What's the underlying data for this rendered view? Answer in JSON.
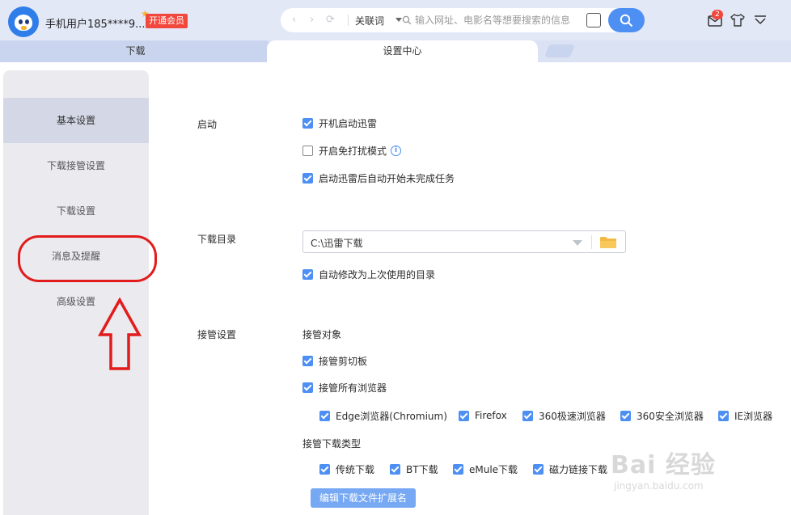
{
  "header": {
    "username": "手机用户185****9...",
    "vip_label": "开通会员",
    "message_count": "2"
  },
  "addressbar": {
    "search_mode": "关联词",
    "placeholder": "输入网址、电影名等想要搜索的信息"
  },
  "tabs": [
    {
      "label": "下载",
      "active": false
    },
    {
      "label": "设置中心",
      "active": true
    }
  ],
  "sidebar": {
    "items": [
      {
        "label": "基本设置",
        "active": true
      },
      {
        "label": "下载接管设置",
        "active": false
      },
      {
        "label": "下载设置",
        "active": false
      },
      {
        "label": "消息及提醒",
        "active": false
      },
      {
        "label": "高级设置",
        "active": false
      }
    ]
  },
  "startup": {
    "label": "启动",
    "options": [
      {
        "label": "开机启动迅雷",
        "checked": true
      },
      {
        "label": "开启免打扰模式",
        "checked": false
      },
      {
        "label": "启动迅雷后自动开始未完成任务",
        "checked": true
      }
    ]
  },
  "download_dir": {
    "label": "下载目录",
    "value": "C:\\迅雷下载",
    "auto_modify": {
      "label": "自动修改为上次使用的目录",
      "checked": true
    }
  },
  "takeover": {
    "label": "接管设置",
    "targets_title": "接管对象",
    "clipboard": {
      "label": "接管剪切板",
      "checked": true
    },
    "all_browsers": {
      "label": "接管所有浏览器",
      "checked": true
    },
    "browsers": [
      {
        "label": "Edge浏览器(Chromium)",
        "checked": true
      },
      {
        "label": "Firefox",
        "checked": true
      },
      {
        "label": "360极速浏览器",
        "checked": true
      },
      {
        "label": "360安全浏览器",
        "checked": true
      },
      {
        "label": "IE浏览器",
        "checked": true
      }
    ],
    "types_title": "接管下载类型",
    "types": [
      {
        "label": "传统下载",
        "checked": true
      },
      {
        "label": "BT下载",
        "checked": true
      },
      {
        "label": "eMule下载",
        "checked": true
      },
      {
        "label": "磁力链接下载",
        "checked": true
      }
    ],
    "edit_ext_button": "编辑下载文件扩展名"
  },
  "watermark": {
    "brand": "Bai 经验",
    "url": "jingyan.baidu.com"
  },
  "colors": {
    "accent": "#4d8ff2",
    "annotation": "#e21b1b"
  }
}
